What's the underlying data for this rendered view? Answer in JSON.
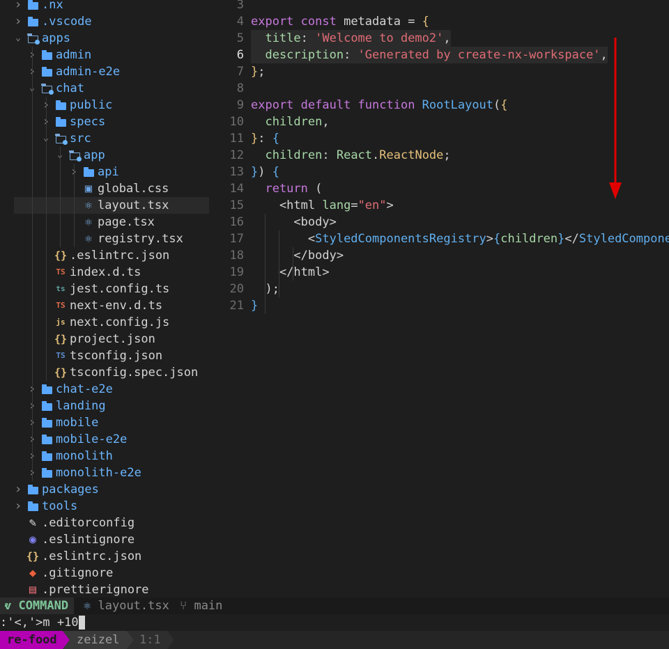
{
  "explorer": {
    "items": [
      {
        "label": ".nx",
        "kind": "dir",
        "depth": 1,
        "expanded": false,
        "icon": "folder-icon"
      },
      {
        "label": ".vscode",
        "kind": "dir",
        "depth": 1,
        "expanded": false,
        "icon": "folder-icon"
      },
      {
        "label": "apps",
        "kind": "dir",
        "depth": 1,
        "expanded": true,
        "icon": "folder-open-icon"
      },
      {
        "label": "admin",
        "kind": "dir",
        "depth": 2,
        "expanded": false,
        "icon": "folder-icon"
      },
      {
        "label": "admin-e2e",
        "kind": "dir",
        "depth": 2,
        "expanded": false,
        "icon": "folder-icon"
      },
      {
        "label": "chat",
        "kind": "dir",
        "depth": 2,
        "expanded": true,
        "icon": "folder-open-icon"
      },
      {
        "label": "public",
        "kind": "dir",
        "depth": 3,
        "expanded": false,
        "icon": "folder-icon"
      },
      {
        "label": "specs",
        "kind": "dir",
        "depth": 3,
        "expanded": false,
        "icon": "folder-icon"
      },
      {
        "label": "src",
        "kind": "dir",
        "depth": 3,
        "expanded": true,
        "icon": "folder-open-icon"
      },
      {
        "label": "app",
        "kind": "dir",
        "depth": 4,
        "expanded": true,
        "icon": "folder-open-icon"
      },
      {
        "label": "api",
        "kind": "dir",
        "depth": 5,
        "expanded": false,
        "icon": "folder-icon"
      },
      {
        "label": "global.css",
        "kind": "file",
        "depth": 5,
        "icon": "css-icon",
        "glyph": "▣",
        "color": "#6ba3e0"
      },
      {
        "label": "layout.tsx",
        "kind": "file",
        "depth": 5,
        "icon": "react-icon",
        "glyph": "⚛",
        "color": "#7fb3e6",
        "selected": true
      },
      {
        "label": "page.tsx",
        "kind": "file",
        "depth": 5,
        "icon": "react-icon",
        "glyph": "⚛",
        "color": "#7fb3e6"
      },
      {
        "label": "registry.tsx",
        "kind": "file",
        "depth": 5,
        "icon": "react-icon",
        "glyph": "⚛",
        "color": "#7fb3e6"
      },
      {
        "label": ".eslintrc.json",
        "kind": "file",
        "depth": 3,
        "icon": "json-icon",
        "glyph": "{}",
        "color": "#e5c07b"
      },
      {
        "label": "index.d.ts",
        "kind": "file",
        "depth": 3,
        "icon": "typescript-def-icon",
        "glyph": "TS",
        "color": "#e06c4a"
      },
      {
        "label": "jest.config.ts",
        "kind": "file",
        "depth": 3,
        "icon": "typescript-config-icon",
        "glyph": "ts",
        "color": "#5f9ea0"
      },
      {
        "label": "next-env.d.ts",
        "kind": "file",
        "depth": 3,
        "icon": "typescript-def-icon",
        "glyph": "TS",
        "color": "#e06c4a"
      },
      {
        "label": "next.config.js",
        "kind": "file",
        "depth": 3,
        "icon": "javascript-icon",
        "glyph": "js",
        "color": "#e5c07b"
      },
      {
        "label": "project.json",
        "kind": "file",
        "depth": 3,
        "icon": "json-icon",
        "glyph": "{}",
        "color": "#e5c07b"
      },
      {
        "label": "tsconfig.json",
        "kind": "file",
        "depth": 3,
        "icon": "tsconfig-icon",
        "glyph": "TS",
        "color": "#5c8fd6"
      },
      {
        "label": "tsconfig.spec.json",
        "kind": "file",
        "depth": 3,
        "icon": "json-icon",
        "glyph": "{}",
        "color": "#e5c07b"
      },
      {
        "label": "chat-e2e",
        "kind": "dir",
        "depth": 2,
        "expanded": false,
        "icon": "folder-icon"
      },
      {
        "label": "landing",
        "kind": "dir",
        "depth": 2,
        "expanded": false,
        "icon": "folder-icon"
      },
      {
        "label": "mobile",
        "kind": "dir",
        "depth": 2,
        "expanded": false,
        "icon": "folder-icon"
      },
      {
        "label": "mobile-e2e",
        "kind": "dir",
        "depth": 2,
        "expanded": false,
        "icon": "folder-icon"
      },
      {
        "label": "monolith",
        "kind": "dir",
        "depth": 2,
        "expanded": false,
        "icon": "folder-icon"
      },
      {
        "label": "monolith-e2e",
        "kind": "dir",
        "depth": 2,
        "expanded": false,
        "icon": "folder-icon"
      },
      {
        "label": "packages",
        "kind": "dir",
        "depth": 1,
        "expanded": false,
        "icon": "folder-icon"
      },
      {
        "label": "tools",
        "kind": "dir",
        "depth": 1,
        "expanded": false,
        "icon": "folder-icon"
      },
      {
        "label": ".editorconfig",
        "kind": "file",
        "depth": 1,
        "icon": "editorconfig-icon",
        "glyph": "✎",
        "color": "#e0e0e0"
      },
      {
        "label": ".eslintignore",
        "kind": "file",
        "depth": 1,
        "icon": "eslint-icon",
        "glyph": "◉",
        "color": "#8080f0"
      },
      {
        "label": ".eslintrc.json",
        "kind": "file",
        "depth": 1,
        "icon": "json-icon",
        "glyph": "{}",
        "color": "#e5c07b"
      },
      {
        "label": ".gitignore",
        "kind": "file",
        "depth": 1,
        "icon": "git-icon",
        "glyph": "◆",
        "color": "#e8603c"
      },
      {
        "label": ".prettierignore",
        "kind": "file",
        "depth": 1,
        "icon": "prettier-icon",
        "glyph": "▤",
        "color": "#e06c75"
      }
    ]
  },
  "editor": {
    "lines": [
      {
        "num": "3",
        "segments": []
      },
      {
        "num": "4",
        "segments": [
          {
            "t": "export ",
            "c": "kw"
          },
          {
            "t": "const ",
            "c": "kw"
          },
          {
            "t": "metadata = ",
            "c": ""
          },
          {
            "t": "{",
            "c": "brace"
          }
        ]
      },
      {
        "num": "5",
        "hl": true,
        "segments": [
          {
            "t": "  title",
            "c": "prop"
          },
          {
            "t": ": ",
            "c": ""
          },
          {
            "t": "'Welcome to demo2'",
            "c": "str"
          },
          {
            "t": ",",
            "c": ""
          }
        ]
      },
      {
        "num": "6",
        "cur": true,
        "hl": true,
        "segments": [
          {
            "t": "  description",
            "c": "prop"
          },
          {
            "t": ": ",
            "c": ""
          },
          {
            "t": "'Generated by create-nx-workspace'",
            "c": "str"
          },
          {
            "t": ",",
            "c": ""
          }
        ]
      },
      {
        "num": "7",
        "segments": [
          {
            "t": "}",
            "c": "brace"
          },
          {
            "t": ";",
            "c": ""
          }
        ]
      },
      {
        "num": "8",
        "segments": []
      },
      {
        "num": "9",
        "segments": [
          {
            "t": "export ",
            "c": "kw"
          },
          {
            "t": "default ",
            "c": "kw"
          },
          {
            "t": "function ",
            "c": "kw"
          },
          {
            "t": "RootLayout",
            "c": "fn"
          },
          {
            "t": "(",
            "c": ""
          },
          {
            "t": "{",
            "c": "brace"
          }
        ]
      },
      {
        "num": "10",
        "segments": [
          {
            "t": "  children",
            "c": "prop"
          },
          {
            "t": ",",
            "c": ""
          }
        ]
      },
      {
        "num": "11",
        "segments": [
          {
            "t": "}",
            "c": "brace"
          },
          {
            "t": ": ",
            "c": ""
          },
          {
            "t": "{",
            "c": "brace2"
          }
        ]
      },
      {
        "num": "12",
        "segments": [
          {
            "t": "  children",
            "c": "prop"
          },
          {
            "t": ": ",
            "c": ""
          },
          {
            "t": "React",
            "c": "prop"
          },
          {
            "t": ".",
            "c": ""
          },
          {
            "t": "ReactNode",
            "c": "type"
          },
          {
            "t": ";",
            "c": ""
          }
        ]
      },
      {
        "num": "13",
        "segments": [
          {
            "t": "}",
            "c": "brace2"
          },
          {
            "t": ") ",
            "c": ""
          },
          {
            "t": "{",
            "c": "brace2"
          }
        ]
      },
      {
        "num": "14",
        "segments": [
          {
            "t": "  return ",
            "c": "kw"
          },
          {
            "t": "(",
            "c": ""
          }
        ]
      },
      {
        "num": "15",
        "segments": [
          {
            "t": "    <html ",
            "c": "tagc"
          },
          {
            "t": "lang",
            "c": "attr"
          },
          {
            "t": "=",
            "c": ""
          },
          {
            "t": "\"en\"",
            "c": "str"
          },
          {
            "t": ">",
            "c": "tagc"
          }
        ]
      },
      {
        "num": "16",
        "segments": [
          {
            "t": "      <body>",
            "c": "tagc"
          }
        ]
      },
      {
        "num": "17",
        "segments": [
          {
            "t": "        <",
            "c": "tagc"
          },
          {
            "t": "StyledComponentsRegistry",
            "c": "cmp"
          },
          {
            "t": ">",
            "c": "tagc"
          },
          {
            "t": "{",
            "c": "brace2"
          },
          {
            "t": "children",
            "c": "prop"
          },
          {
            "t": "}",
            "c": "brace2"
          },
          {
            "t": "</",
            "c": "tagc"
          },
          {
            "t": "StyledComponen",
            "c": "cmp"
          }
        ]
      },
      {
        "num": "18",
        "segments": [
          {
            "t": "      </body>",
            "c": "tagc"
          }
        ]
      },
      {
        "num": "19",
        "segments": [
          {
            "t": "    </html>",
            "c": "tagc"
          }
        ]
      },
      {
        "num": "20",
        "segments": [
          {
            "t": "  );",
            "c": ""
          }
        ]
      },
      {
        "num": "21",
        "segments": [
          {
            "t": "}",
            "c": "brace2"
          }
        ]
      }
    ]
  },
  "statusbar": {
    "mode": "COMMAND",
    "mode_color": "#7ec699",
    "file": "layout.tsx",
    "branch": "main"
  },
  "cmdline": {
    "text": ":'<,'>m +10"
  },
  "bottombar": {
    "session": "re-food",
    "session_color": "#b300b3",
    "window": "zeizel",
    "position": "1:1"
  },
  "annotation": {
    "arrow_color": "#e00000"
  }
}
